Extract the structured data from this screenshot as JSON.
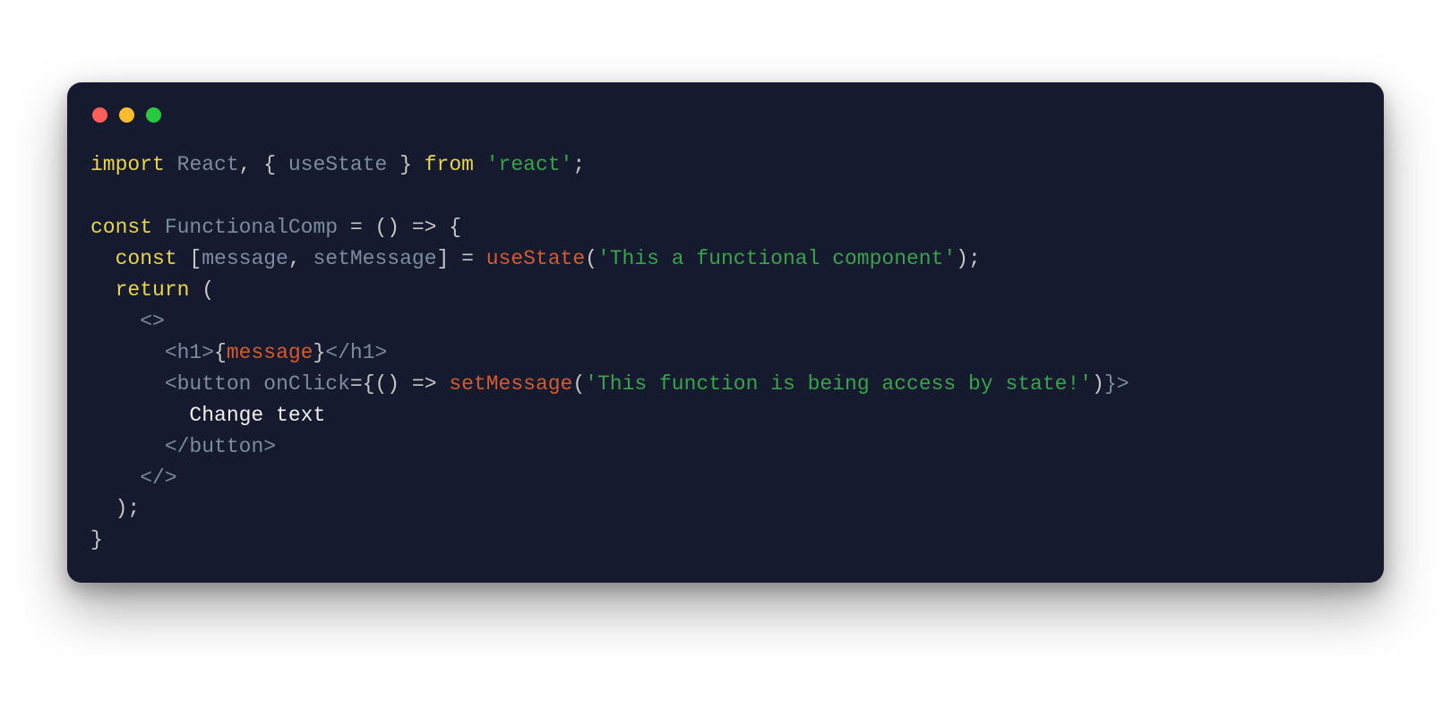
{
  "code": {
    "line1": {
      "import": "import",
      "react": "React",
      "comma_space": ", ",
      "lbrace": "{ ",
      "usestate": "useState",
      "rbrace": " }",
      "from": " from ",
      "react_str": "'react'",
      "semi": ";"
    },
    "line3": {
      "const": "const",
      "name": " FunctionalComp",
      "rest": " = () => {"
    },
    "line4": {
      "indent": "  ",
      "const": "const",
      "open": " [",
      "message": "message",
      "comma": ", ",
      "setmessage": "setMessage",
      "close_eq": "] = ",
      "usestate": "useState",
      "lparen": "(",
      "str": "'This a functional component'",
      "rparen_semi": ");"
    },
    "line5": {
      "indent": "  ",
      "return": "return",
      "paren": " ("
    },
    "line6": {
      "indent": "    ",
      "frag_open": "<>"
    },
    "line7": {
      "indent": "      ",
      "h1_open": "<h1>",
      "lbrace": "{",
      "expr": "message",
      "rbrace": "}",
      "h1_close": "</h1>"
    },
    "line8": {
      "indent": "      ",
      "btn_open": "<button",
      "space": " ",
      "attr": "onClick",
      "eq_lbrace": "={",
      "arrow": "() => ",
      "call": "setMessage",
      "lparen": "(",
      "str": "'This function is being access by state!'",
      "rparen": ")",
      "rbrace_gt": "}>"
    },
    "line9": {
      "indent": "        ",
      "text": "Change text"
    },
    "line10": {
      "indent": "      ",
      "btn_close": "</button>"
    },
    "line11": {
      "indent": "    ",
      "frag_close": "</>"
    },
    "line12": {
      "indent": "  ",
      "close": ");"
    },
    "line13": {
      "close": "}"
    }
  },
  "colors": {
    "bg": "#151a2e",
    "keyword": "#e8d44d",
    "identifier": "#7c8ba1",
    "function": "#d35b2f",
    "string": "#3aa24a",
    "text": "#f0f0f0"
  }
}
